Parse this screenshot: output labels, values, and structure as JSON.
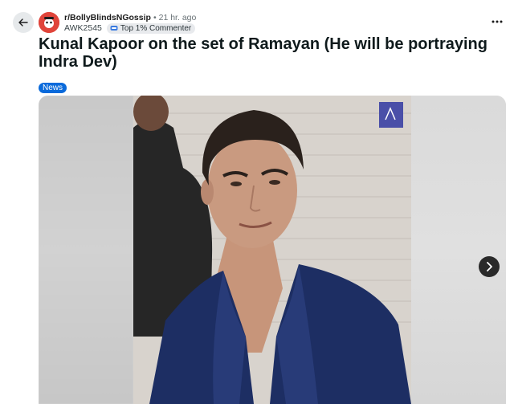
{
  "post": {
    "subreddit": "r/BollyBlindsNGossip",
    "separator": "•",
    "time_ago": "21 hr. ago",
    "author": "AWK2545",
    "author_flair": "Top 1% Commenter",
    "title": "Kunal Kapoor on the set of Ramayan (He will be portraying Indra Dev)",
    "post_flair": "News"
  },
  "icons": {
    "back": "arrow-left-icon",
    "more": "more-horizontal-icon",
    "next": "chevron-right-icon",
    "flair": "trophy-icon"
  },
  "colors": {
    "news_flair_bg": "#0a6adb",
    "avatar_bg": "#e0443a"
  }
}
